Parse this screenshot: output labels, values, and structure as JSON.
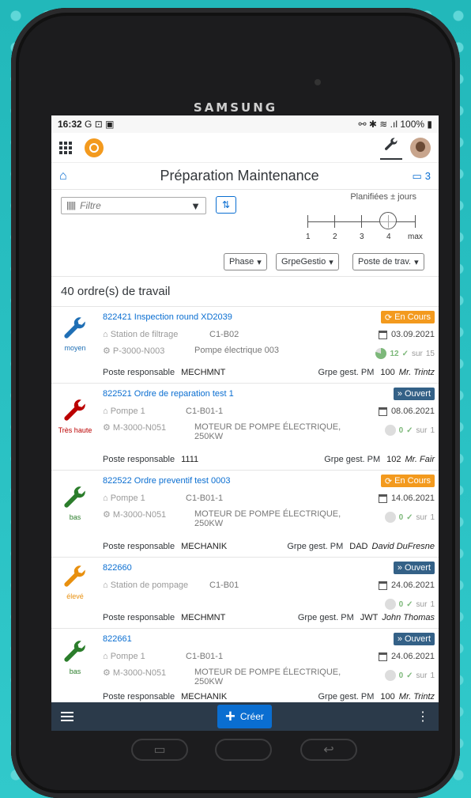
{
  "device": {
    "brand": "SAMSUNG"
  },
  "statusbar": {
    "time": "16:32",
    "left_icons": "G ⊡ ▣",
    "right": "100%"
  },
  "header": {
    "title": "Préparation Maintenance",
    "notification_count": "3"
  },
  "filter": {
    "placeholder": "Filtre",
    "planned_label": "Planifiées ± jours",
    "slider": {
      "ticks": [
        "1",
        "2",
        "3",
        "4",
        "max"
      ],
      "value": "4"
    },
    "selects": [
      "Phase",
      "GrpeGestio",
      "Poste de trav."
    ]
  },
  "list": {
    "count_text": "40 ordre(s) de travail",
    "labels": {
      "poste": "Poste responsable",
      "grpe": "Grpe gest. PM",
      "sur": "sur"
    },
    "orders": [
      {
        "id_title": "822421  Inspection round XD2039",
        "status": "En Cours",
        "status_color": "#f39a1e",
        "location": "Station de filtrage",
        "func_loc": "C1-B02",
        "equipment": "P-3000-N003",
        "equip_desc": "Pompe électrique 003",
        "date": "03.09.2021",
        "done": "12",
        "total": "15",
        "poste": "MECHMNT",
        "grpe": "100",
        "person": "Mr. Trintz",
        "priority": "moyen",
        "priority_color": "#1f6fb5"
      },
      {
        "id_title": "822521  Ordre de reparation test 1",
        "status": "Ouvert",
        "status_color": "#346187",
        "location": "Pompe 1",
        "func_loc": "C1-B01-1",
        "equipment": "M-3000-N051",
        "equip_desc": "MOTEUR DE POMPE ÉLECTRIQUE, 250KW",
        "date": "08.06.2021",
        "done": "0",
        "total": "1",
        "poste": "1111",
        "grpe": "102",
        "person": "Mr. Fair",
        "priority": "Très haute",
        "priority_color": "#b00"
      },
      {
        "id_title": "822522  Ordre preventif test 0003",
        "status": "En Cours",
        "status_color": "#f39a1e",
        "location": "Pompe 1",
        "func_loc": "C1-B01-1",
        "equipment": "M-3000-N051",
        "equip_desc": "MOTEUR DE POMPE ÉLECTRIQUE, 250KW",
        "date": "14.06.2021",
        "done": "0",
        "total": "1",
        "poste": "MECHANIK",
        "grpe": "DAD",
        "person": "David DuFresne",
        "priority": "bas",
        "priority_color": "#2b7d2b"
      },
      {
        "id_title": "822660",
        "status": "Ouvert",
        "status_color": "#346187",
        "location": "Station de pompage",
        "func_loc": "C1-B01",
        "equipment": "",
        "equip_desc": "",
        "date": "24.06.2021",
        "done": "0",
        "total": "1",
        "poste": "MECHMNT",
        "grpe": "JWT",
        "person": "John Thomas",
        "priority": "élevé",
        "priority_color": "#e8900f"
      },
      {
        "id_title": "822661",
        "status": "Ouvert",
        "status_color": "#346187",
        "location": "Pompe 1",
        "func_loc": "C1-B01-1",
        "equipment": "M-3000-N051",
        "equip_desc": "MOTEUR DE POMPE ÉLECTRIQUE, 250KW",
        "date": "24.06.2021",
        "done": "0",
        "total": "1",
        "poste": "MECHANIK",
        "grpe": "100",
        "person": "Mr. Trintz",
        "priority": "bas",
        "priority_color": "#2b7d2b"
      }
    ]
  },
  "footer": {
    "create_label": "Créer"
  }
}
